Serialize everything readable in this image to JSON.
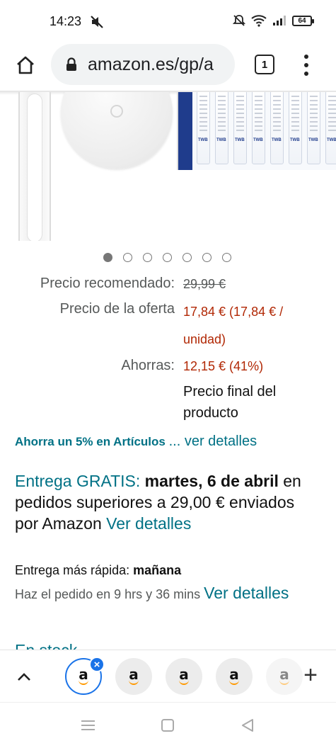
{
  "status_bar": {
    "time": "14:23",
    "battery": "64",
    "icons": [
      "mute-icon",
      "alarm-off-icon",
      "wifi-icon",
      "signal-icon",
      "battery-icon"
    ]
  },
  "browser": {
    "url": "amazon.es/gp/a",
    "tab_count": "1",
    "icons": [
      "home-icon",
      "lock-icon",
      "tabs-icon",
      "more-vert-icon"
    ]
  },
  "carousel": {
    "total": 7,
    "active_index": 0
  },
  "pricing": {
    "list_label": "Precio recomendado:",
    "list_price": "29,99 €",
    "deal_label": "Precio de la oferta",
    "deal_price_line1": "17,84 € (17,84 € /",
    "deal_price_line2": "unidad)",
    "savings_label": "Ahorras:",
    "savings_value": "12,15 € (41%)",
    "final_note": "Precio final del producto"
  },
  "promo": {
    "text": "Ahorra un 5% en Artículos",
    "link": "... ver detalles"
  },
  "delivery": {
    "free_label": "Entrega GRATIS:",
    "date_part1": "martes, 6 de",
    "date_part2": "abril",
    "condition": "en pedidos superiores a 29,00 € enviados por Amazon",
    "details_link": "Ver detalles",
    "fastest_label": "Entrega más rápida:",
    "fastest_value": "mañana",
    "order_within": "Haz el pedido en 9 hrs y 36 mins",
    "order_details_link": "Ver detalles",
    "stock_text": "En stock"
  },
  "tab_strip": {
    "tab_logo": "a",
    "icons": [
      "chevron-up-icon",
      "close-icon",
      "plus-icon"
    ]
  },
  "nav_bar": {
    "icons": [
      "recents-icon",
      "home-icon",
      "back-icon"
    ]
  },
  "colors": {
    "teal_link": "#007185",
    "price_red": "#b12704",
    "muted_text": "#565959",
    "chrome_blue": "#1a73e8",
    "amazon_orange": "#ff9900"
  }
}
